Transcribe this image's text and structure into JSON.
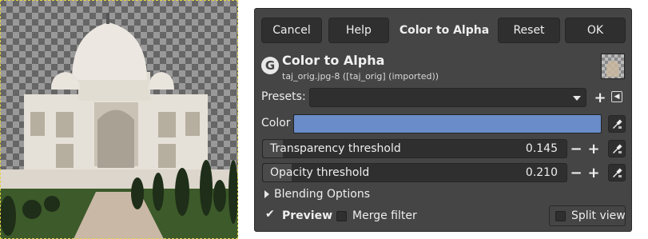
{
  "dialog": {
    "buttons": {
      "cancel": "Cancel",
      "help": "Help",
      "title": "Color to Alpha",
      "reset": "Reset",
      "ok": "OK"
    },
    "header": {
      "icon": "G",
      "title": "Color to Alpha",
      "subtitle": "taj_orig.jpg-8 ([taj_orig] (imported))"
    },
    "presets": {
      "label": "Presets:",
      "value": ""
    },
    "color": {
      "label": "Color",
      "value": "#6a8cc8"
    },
    "transparency": {
      "label": "Transparency threshold",
      "value": "0.145",
      "fraction": 0.145
    },
    "opacity": {
      "label": "Opacity threshold",
      "value": "0.210",
      "fraction": 0.21
    },
    "blending": {
      "label": "Blending Options"
    },
    "preview": {
      "label": "Preview",
      "checked": true
    },
    "merge": {
      "label": "Merge filter",
      "checked": false
    },
    "split": {
      "label": "Split view",
      "checked": false
    }
  },
  "icons": [
    "gimp-logo-icon",
    "preset-add-icon",
    "preset-menu-icon",
    "color-picker-icon",
    "minus-icon",
    "plus-icon",
    "expander-arrow-icon",
    "checkmark-icon"
  ],
  "colors": {
    "dialog_bg": "#454545",
    "field_bg": "#2f2f2f",
    "swatch": "#6a8cc8",
    "canvas_border": "#e3d24a"
  }
}
